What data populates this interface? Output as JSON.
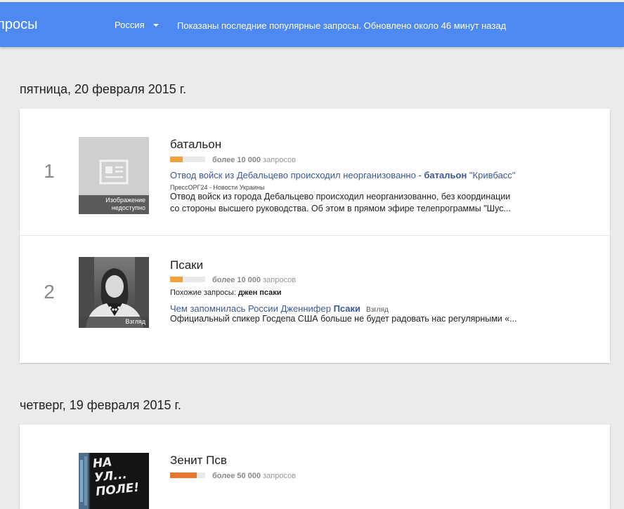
{
  "header": {
    "title": "просы",
    "region": "Россия",
    "status": "Показаны последние популярные запросы. Обновлено около 46 минут назад"
  },
  "days": [
    {
      "date": "пятница, 20 февраля 2015 г.",
      "items": [
        {
          "rank": "1",
          "title": "батальон",
          "volume": "более 10 000",
          "volume_suffix": "запросов",
          "volume_level": 0.35,
          "volume_color": "#f4a13c",
          "thumb_caption_line1": "Изображение",
          "thumb_caption_line2": "недоступно",
          "news_link_a": "Отвод войск из Дебальцево происходил неорганизованно - ",
          "news_link_b": "батальон",
          "news_link_c": " \"Кривбасс\"",
          "news_source": "ПрессОРГ24 - Новости Украины",
          "snippet_line1": "Отвод войск из города Дебальцево происходил неорганизованно, без координации",
          "snippet_line2": "со стороны высшего руководства. Об этом в прямом эфире телепрограммы \"Шус..."
        },
        {
          "rank": "2",
          "title": "Псаки",
          "volume": "более 10 000",
          "volume_suffix": "запросов",
          "volume_level": 0.35,
          "volume_color": "#f4a13c",
          "thumb_caption": "Взгляд",
          "related_label": "Похожие запросы: ",
          "related_query": "джен псаки",
          "news_link_a": "Чем запомнилась России Дженнифер ",
          "news_link_b": "Псаки",
          "news_source_inline": "Взгляд",
          "snippet_line1": "Официальный спикер Госдепа США больше не будет радовать нас регулярными «..."
        }
      ]
    },
    {
      "date": "четверг, 19 февраля 2015 г.",
      "items": [
        {
          "rank": "",
          "title": "Зенит Псв",
          "volume": "более 50 000",
          "volume_suffix": "запросов",
          "volume_level": 0.75,
          "volume_color": "#e8772e",
          "thumb_text": "НА УЛ... ПОЛЕ!"
        }
      ]
    }
  ]
}
